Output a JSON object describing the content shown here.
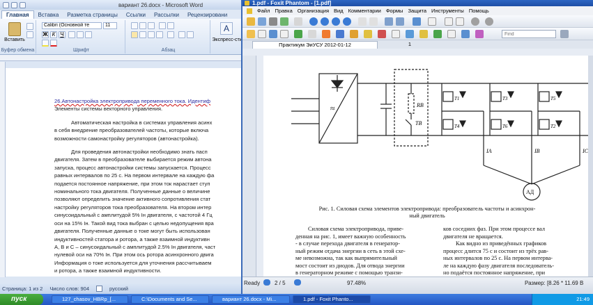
{
  "word": {
    "title": "вариант 26.docx - Microsoft Word",
    "tabs": [
      "Главная",
      "Вставка",
      "Разметка страницы",
      "Ссылки",
      "Рассылки",
      "Рецензировани"
    ],
    "font_name": "Calibri (Основной те",
    "font_size": "11",
    "groups": {
      "clipboard": "Буфер обмена",
      "font": "Шрифт",
      "paragraph": "Абзац"
    },
    "paste_label": "Вставить",
    "express_style": "Экспресс-сти",
    "doc_lines": [
      {
        "t": "26.Автонастройка электропривода переменного тока. Идентиф",
        "c": "ul"
      },
      {
        "t": "Элементы системы векторного управления.",
        "c": ""
      },
      {
        "t": "Автоматическая настройка в системах управления асинх",
        "c": "ind sp"
      },
      {
        "t": "в себя внедрение преобразователей частоты, которые включа",
        "c": ""
      },
      {
        "t": "возможности самонастройку регуляторов (автонастройка).",
        "c": ""
      },
      {
        "t": "Для проведения автонастройки необходимо знать пасп",
        "c": "ind sp"
      },
      {
        "t": "двигателя. Затем в преобразователе выбирается режим автона",
        "c": ""
      },
      {
        "t": "запуска, процесс автонастройки системы запускается. Процесс",
        "c": ""
      },
      {
        "t": "равных интервалов по 25 с. На первом интервале на каждую фа",
        "c": ""
      },
      {
        "t": "подается постоянное напряжение, при этом ток нарастает ступ",
        "c": ""
      },
      {
        "t": "номинального тока двигателя. Полученные данные о величине",
        "c": ""
      },
      {
        "t": "позволяют определить значение активного сопротивления стат",
        "c": ""
      },
      {
        "t": "настройку регуляторов тока преобразователя. На втором интер",
        "c": ""
      },
      {
        "t": "синусоидальный с амплитудой 5% Iн двигателя, с частотой 4 Гц",
        "c": ""
      },
      {
        "t": "оси на 15% Iн. Такой вид тока выбран с целью недопущения вра",
        "c": ""
      },
      {
        "t": "двигателя. Полученные данные о токе могут быть использован",
        "c": ""
      },
      {
        "t": "индуктивностей статора и ротора, а также взаимной индуктивн",
        "c": ""
      },
      {
        "t": "А, В и С – синусоидальный с амплитудой 2.5% Iн двигателя, част",
        "c": ""
      },
      {
        "t": "нулевой оси на 70% Iн. При этом ось ротора асинхронного двига",
        "c": ""
      },
      {
        "t": "Информация о токе используется для уточнения рассчитываем",
        "c": ""
      },
      {
        "t": "и ротора, а также взаимной индуктивности.",
        "c": ""
      }
    ],
    "status": {
      "page": "Страница: 1 из 2",
      "words": "Число слов: 904",
      "lang": "русский"
    }
  },
  "foxit": {
    "title": "1.pdf - Foxit Phantom - [1.pdf]",
    "menu": [
      "Файл",
      "Правка",
      "Организация",
      "Вид",
      "Комментарии",
      "Формы",
      "Защита",
      "Инструменты",
      "Помощь"
    ],
    "find_placeholder": "Find",
    "tab_doc": "Практикум ЭиУСУ 2012-01-12",
    "tab_page": "1",
    "labels": {
      "rb": "RB",
      "tb": "TB",
      "t1": "T1",
      "t3": "T3",
      "t5": "T5",
      "t4": "T4",
      "t6": "T6",
      "t2": "T2",
      "ia": "IA",
      "ib": "IB",
      "ic": "IC",
      "motor": "АД",
      "approx": "≈"
    },
    "caption_1": "Рис. 1. Силовая схема элементов электропривода: преобразователь частоты и асинхрон-",
    "caption_2": "ный двигатель",
    "col_left": [
      "Силовая схема электропривода, приве-",
      "денная на рис. 1, имеет важную особенность",
      "- в случае перехода двигателя в генератор-",
      "ный режим отдача энергии в сеть в этой схе-",
      "ме невозможна, так как выпрямительный",
      "мост состоит из диодов. Для отвода энергии",
      "в генераторном режиме с помощью транзи-",
      "стора Тв включается в работу балластный"
    ],
    "col_right": [
      "ков соседних фаз. При этом процессе вал",
      "двигателя не вращается.",
      "Как видно из приведённых графиков",
      "процесс длится 75 с и состоит из трёх рав-",
      "ных интервалов по 25 с. На первом интерва-",
      "ле на каждую фазу двигателя последователь-",
      "но подаётся постоянное напряжение, при",
      "этом ток нарастает ступенчато до"
    ],
    "status": {
      "ready": "Ready",
      "page": "2 / 5",
      "zoom": "97.48%",
      "size": "Размер: [8.26 * 11.69 В"
    }
  },
  "taskbar": {
    "start": "пуск",
    "tasks": [
      "127_chasov_HBRp_[...",
      "C:\\Documents and Se...",
      "вариант 26.docx - Mi...",
      "1.pdf - Foxit Phanto..."
    ],
    "clock": "21:49"
  }
}
